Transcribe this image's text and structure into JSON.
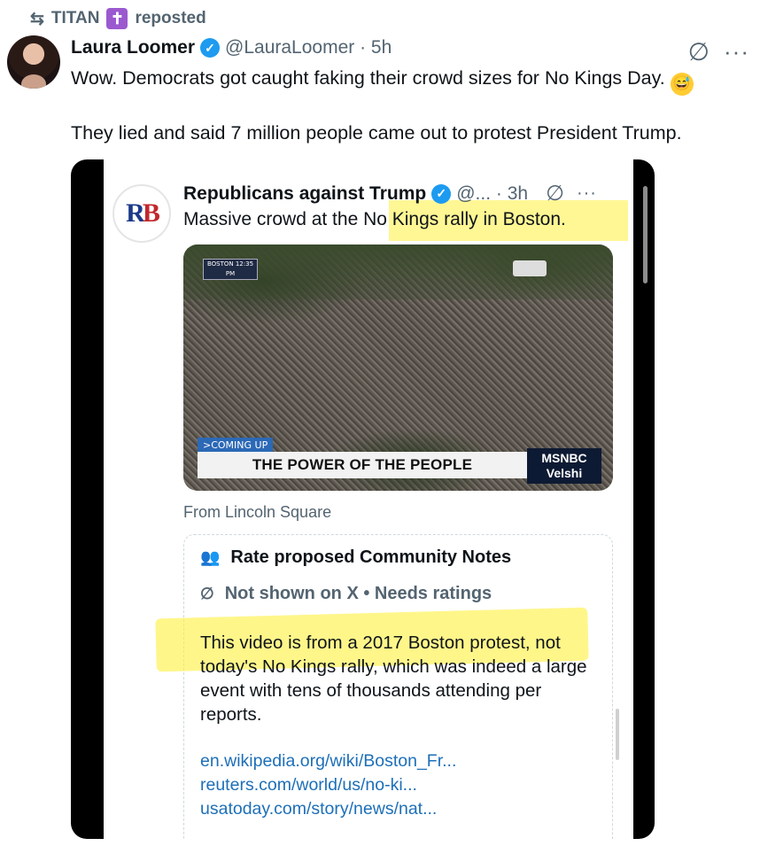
{
  "repost": {
    "reposter": "TITAN",
    "label": "reposted",
    "repost_icon": "repost-icon",
    "badge_icon": "cross-icon"
  },
  "tweet": {
    "author_name": "Laura Loomer",
    "handle_time": "@LauraLoomer · 5h",
    "line1": "Wow. Democrats got caught faking their crowd sizes for No Kings Day.",
    "line2": "They lied and said 7 million people came out to protest President Trump.",
    "emoji": "grinning-sweat-emoji"
  },
  "embedded": {
    "author_name": "Republicans against Trump",
    "handle_time": "@... · 3h",
    "avatar_text": "RB",
    "text": "Massive crowd at the No Kings rally in Boston.",
    "video": {
      "location_tag": "BOSTON 12:35 PM",
      "coming_up": ">COMING UP",
      "banner": "THE POWER OF THE PEOPLE",
      "network": "MSNBC Velshi"
    },
    "caption": "From Lincoln Square",
    "community_notes": {
      "heading": "Rate proposed Community Notes",
      "status": "Not shown on X • Needs ratings",
      "body": "This video is from a 2017 Boston protest, not today's No Kings rally, which was indeed a large event with tens of thousands attending per reports.",
      "links": [
        "en.wikipedia.org/wiki/Boston_Fr...",
        "reuters.com/world/us/no-ki...",
        "usatoday.com/story/news/nat..."
      ]
    }
  },
  "colors": {
    "verified_blue": "#1d9bf0",
    "highlight": "#fff03c",
    "link": "#1d6fb8",
    "muted": "#536471"
  }
}
